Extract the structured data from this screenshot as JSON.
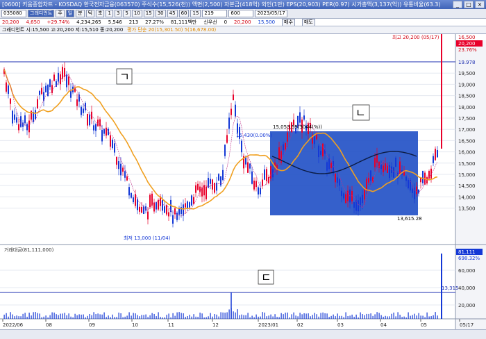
{
  "title": "[0600] 키움종합차트 - KOSDAQ 한국전자금융(063570) 주식수(15,526(천)) 액면(2,500) 자본금(418억) 외인(1만) EPS(20,903) PER(0.97) 시가총액(3,137(억)) 유통비율(63.3)",
  "window_buttons": [
    "_",
    "□",
    "×"
  ],
  "toolbar": {
    "items": [
      "주",
      "일",
      "분",
      "틱",
      "초",
      "1",
      "3",
      "5",
      "10",
      "15",
      "30",
      "45",
      "60",
      "15"
    ],
    "code": "035080",
    "name": "그래디언트",
    "count": "219",
    "period": "600",
    "date": "2023/05/17"
  },
  "infobar": {
    "price": "20,200",
    "change": "4,650",
    "pct": "+29.74%",
    "volume": "4,234,265",
    "turnover": "5,546",
    "ratio": "213",
    "rate": "27.27%",
    "amount": "81,111백만",
    "credit": "신우선",
    "zero": "0",
    "hi_label": "고",
    "hi": "20,200",
    "lo_label": "저",
    "lo": "15,500",
    "last_a": "20,200",
    "last_b": "15,510",
    "buy": "매수",
    "sell": "매도"
  },
  "legend": {
    "price": "그래디언트 시:15,500 고:20,200 저:15,510 종:20,200",
    "ma": "평가 단순 20(15,301.50) 5(16,678.00)"
  },
  "annotations": {
    "g": "ㄱ",
    "n": "ㄴ",
    "d": "ㄷ",
    "high": "최고 20,200 (05/17)",
    "low": "최저 13,000 (11/04)",
    "box_top": "15,053.59(3044(%))",
    "box_bottom": "13,615.28",
    "mid": "15,430(0.00%)",
    "volume_panel": "거래대금(81,111,000)",
    "vol_line": "13,315"
  },
  "price_axis": [
    "19.978",
    "19,500",
    "19,000",
    "18,500",
    "18,000",
    "17,500",
    "17,000",
    "16,500",
    "16,000",
    "15,500",
    "15,000",
    "14,500",
    "14,000",
    "13,500"
  ],
  "price_axis_top": {
    "a": "16,500",
    "b": "20,200",
    "c": "23.76%"
  },
  "volume_axis": [
    "60,000",
    "40,000",
    "20,000"
  ],
  "volume_axis_top": {
    "a": "81,111",
    "b": "698.32%"
  },
  "date_axis": [
    "2022/06",
    "08",
    "09",
    "10",
    "11",
    "12",
    "2023/01",
    "02",
    "03",
    "04",
    "05",
    "05/17"
  ],
  "chart_data": {
    "type": "candlestick",
    "price_ylim": [
      13500,
      20300
    ],
    "high": 20200,
    "low": 13000,
    "last": 20200,
    "ma20_last": 15301.5,
    "ma5_last": 16678,
    "volume_last": 81111,
    "volume_ylim": [
      0,
      85000
    ],
    "colors": {
      "up": "#e8002a",
      "down": "#1438d6",
      "ma": "#f0a020",
      "box": "#2453c7",
      "hline": "#1d2fb0"
    }
  }
}
